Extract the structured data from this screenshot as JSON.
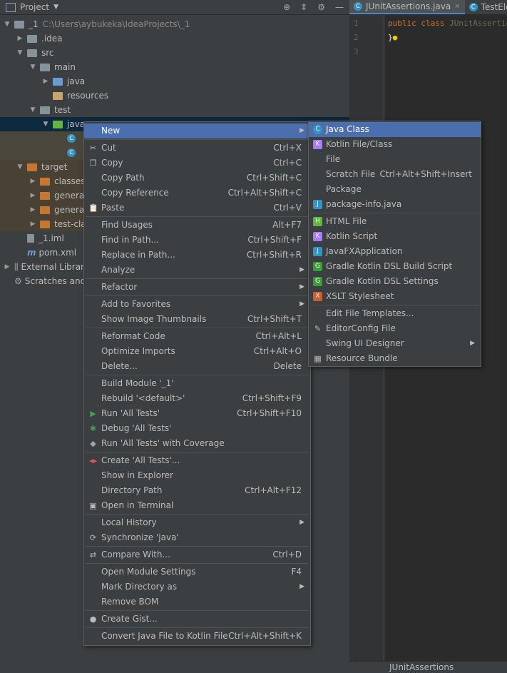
{
  "project_panel": {
    "title": "Project"
  },
  "tree": [
    {
      "label": "_1",
      "path": "C:\\Users\\aybukeka\\IdeaProjects\\_1"
    },
    {
      "label": ".idea"
    },
    {
      "label": "src"
    },
    {
      "label": "main"
    },
    {
      "label": "java"
    },
    {
      "label": "resources"
    },
    {
      "label": "test"
    },
    {
      "label": "java"
    },
    {
      "label": "target"
    },
    {
      "label": "classes"
    },
    {
      "label": "generat"
    },
    {
      "label": "generat"
    },
    {
      "label": "test-cla"
    },
    {
      "label": "_1.iml"
    },
    {
      "label": "pom.xml"
    },
    {
      "label": "External Librar"
    },
    {
      "label": "Scratches and"
    }
  ],
  "editor": {
    "tabs": [
      {
        "label": "JUnitAssertions.java"
      },
      {
        "label": "TestElem"
      }
    ],
    "line_numbers": [
      "1",
      "2",
      "3"
    ],
    "code": {
      "kw1": "public",
      "kw2": "class",
      "cls": "JUnitAssertio",
      "brace": "}"
    }
  },
  "status": {
    "text": "JUnitAssertions"
  },
  "context_menu": {
    "items": [
      {
        "label": "New",
        "shortcut": "",
        "submenu": true,
        "icon": ""
      },
      {
        "label": "Cut",
        "shortcut": "Ctrl+X",
        "icon": "✂"
      },
      {
        "label": "Copy",
        "shortcut": "Ctrl+C",
        "icon": "❐"
      },
      {
        "label": "Copy Path",
        "shortcut": "Ctrl+Shift+C",
        "icon": ""
      },
      {
        "label": "Copy Reference",
        "shortcut": "Ctrl+Alt+Shift+C",
        "icon": ""
      },
      {
        "label": "Paste",
        "shortcut": "Ctrl+V",
        "icon": "📋"
      },
      {
        "label": "Find Usages",
        "shortcut": "Alt+F7",
        "icon": ""
      },
      {
        "label": "Find in Path...",
        "shortcut": "Ctrl+Shift+F",
        "icon": ""
      },
      {
        "label": "Replace in Path...",
        "shortcut": "Ctrl+Shift+R",
        "icon": ""
      },
      {
        "label": "Analyze",
        "shortcut": "",
        "submenu": true,
        "icon": ""
      },
      {
        "label": "Refactor",
        "shortcut": "",
        "submenu": true,
        "icon": ""
      },
      {
        "label": "Add to Favorites",
        "shortcut": "",
        "submenu": true,
        "icon": ""
      },
      {
        "label": "Show Image Thumbnails",
        "shortcut": "Ctrl+Shift+T",
        "icon": ""
      },
      {
        "label": "Reformat Code",
        "shortcut": "Ctrl+Alt+L",
        "icon": ""
      },
      {
        "label": "Optimize Imports",
        "shortcut": "Ctrl+Alt+O",
        "icon": ""
      },
      {
        "label": "Delete...",
        "shortcut": "Delete",
        "icon": ""
      },
      {
        "label": "Build Module '_1'",
        "shortcut": "",
        "icon": ""
      },
      {
        "label": "Rebuild '<default>'",
        "shortcut": "Ctrl+Shift+F9",
        "icon": ""
      },
      {
        "label": "Run 'All Tests'",
        "shortcut": "Ctrl+Shift+F10",
        "icon": "▶"
      },
      {
        "label": "Debug 'All Tests'",
        "shortcut": "",
        "icon": "✱"
      },
      {
        "label": "Run 'All Tests' with Coverage",
        "shortcut": "",
        "icon": "◆"
      },
      {
        "label": "Create 'All Tests'...",
        "shortcut": "",
        "icon": "◂▸"
      },
      {
        "label": "Show in Explorer",
        "shortcut": "",
        "icon": ""
      },
      {
        "label": "Directory Path",
        "shortcut": "Ctrl+Alt+F12",
        "icon": ""
      },
      {
        "label": "Open in Terminal",
        "shortcut": "",
        "icon": "▣"
      },
      {
        "label": "Local History",
        "shortcut": "",
        "submenu": true,
        "icon": ""
      },
      {
        "label": "Synchronize 'java'",
        "shortcut": "",
        "icon": "⟳"
      },
      {
        "label": "Compare With...",
        "shortcut": "Ctrl+D",
        "icon": "⇄"
      },
      {
        "label": "Open Module Settings",
        "shortcut": "F4",
        "icon": ""
      },
      {
        "label": "Mark Directory as",
        "shortcut": "",
        "submenu": true,
        "icon": ""
      },
      {
        "label": "Remove BOM",
        "shortcut": "",
        "icon": ""
      },
      {
        "label": "Create Gist...",
        "shortcut": "",
        "icon": "●"
      },
      {
        "label": "Convert Java File to Kotlin File",
        "shortcut": "Ctrl+Alt+Shift+K",
        "icon": ""
      }
    ]
  },
  "new_submenu": {
    "items": [
      {
        "label": "Java Class",
        "shortcut": "",
        "icon": "C"
      },
      {
        "label": "Kotlin File/Class",
        "shortcut": "",
        "icon": "K"
      },
      {
        "label": "File",
        "shortcut": "",
        "icon": ""
      },
      {
        "label": "Scratch File",
        "shortcut": "Ctrl+Alt+Shift+Insert",
        "icon": ""
      },
      {
        "label": "Package",
        "shortcut": "",
        "icon": ""
      },
      {
        "label": "package-info.java",
        "shortcut": "",
        "icon": "J"
      },
      {
        "label": "HTML File",
        "shortcut": "",
        "icon": "H"
      },
      {
        "label": "Kotlin Script",
        "shortcut": "",
        "icon": "K"
      },
      {
        "label": "JavaFXApplication",
        "shortcut": "",
        "icon": "J"
      },
      {
        "label": "Gradle Kotlin DSL Build Script",
        "shortcut": "",
        "icon": "G"
      },
      {
        "label": "Gradle Kotlin DSL Settings",
        "shortcut": "",
        "icon": "G"
      },
      {
        "label": "XSLT Stylesheet",
        "shortcut": "",
        "icon": "X"
      },
      {
        "label": "Edit File Templates...",
        "shortcut": "",
        "icon": ""
      },
      {
        "label": "EditorConfig File",
        "shortcut": "",
        "icon": "✎"
      },
      {
        "label": "Swing UI Designer",
        "shortcut": "",
        "submenu": true,
        "icon": ""
      },
      {
        "label": "Resource Bundle",
        "shortcut": "",
        "icon": "▦"
      }
    ]
  }
}
